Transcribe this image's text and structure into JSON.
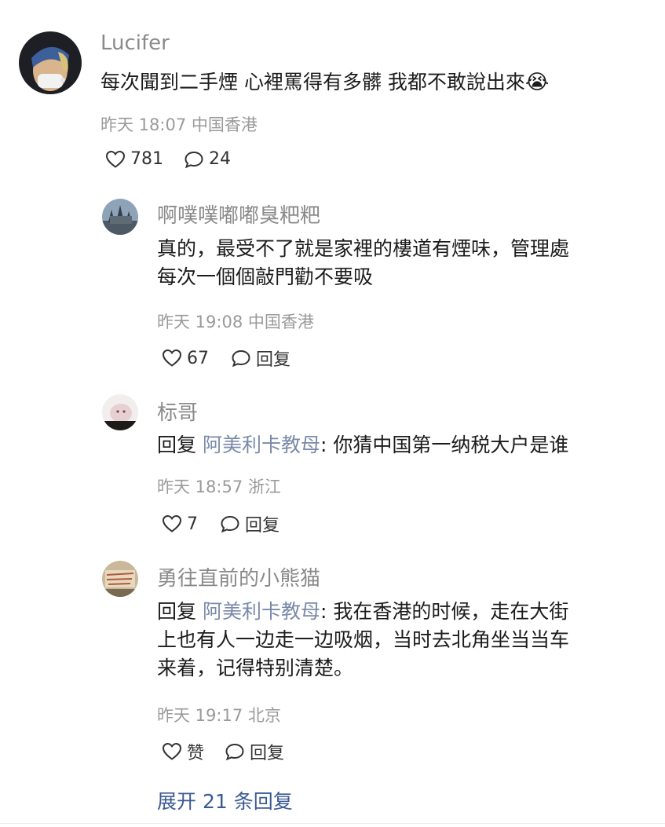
{
  "comment": {
    "user": "Lucifer",
    "text": "每次聞到二手煙 心裡罵得有多髒 我都不敢說出來",
    "emoji": "😭",
    "time": "昨天 18:07",
    "location": "中国香港",
    "likes": "781",
    "replies_count": "24"
  },
  "replies": [
    {
      "user": "啊噗噗嘟嘟臭粑粑",
      "line1": "真的，最受不了就是家裡的樓道有煙味，管理處",
      "line2": "每次一個個敲門勸不要吸",
      "time": "昨天 19:08",
      "location": "中国香港",
      "likes": "67",
      "reply_label": "回复"
    },
    {
      "user": "标哥",
      "reply_prefix": "回复",
      "reply_to": "阿美利卡教母",
      "line1": ": 你猜中国第一纳税大户是谁",
      "time": "昨天 18:57",
      "location": "浙江",
      "likes": "7",
      "reply_label": "回复"
    },
    {
      "user": "勇往直前的小熊猫",
      "reply_prefix": "回复",
      "reply_to": "阿美利卡教母",
      "line1": ": 我在香港的时候，走在大街",
      "line2": "上也有人一边走一边吸烟，当时去北角坐当当车",
      "line3": "来着，记得特别清楚。",
      "time": "昨天 19:17",
      "location": "北京",
      "likes": "赞",
      "reply_label": "回复"
    }
  ],
  "expand_label": "展开 21 条回复",
  "colors": {
    "name": "#8a8a8a",
    "meta": "#9a9a9a",
    "link": "#3a5a92",
    "mention": "#7a8aa8"
  },
  "icons": {
    "like": "heart-outline-icon",
    "comment": "speech-bubble-icon"
  }
}
